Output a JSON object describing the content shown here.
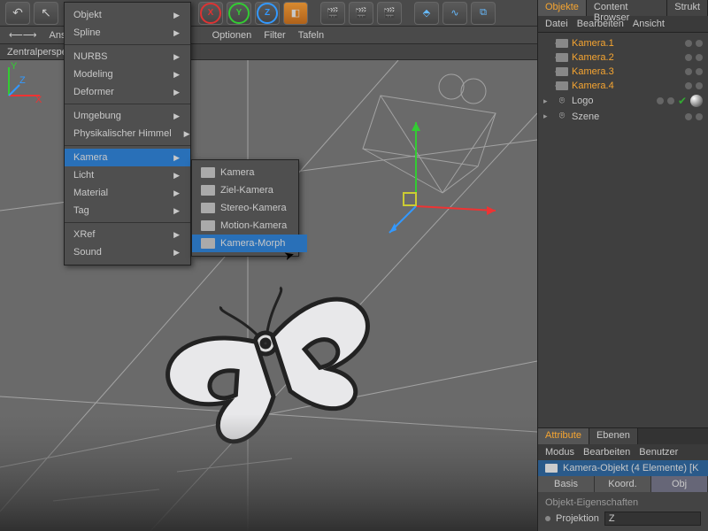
{
  "toolbar": {
    "axes": [
      "X",
      "Y",
      "Z"
    ]
  },
  "viewport_bar": {
    "ansicht": "Ansicht",
    "kameras": "",
    "optionen": "Optionen",
    "filter": "Filter",
    "tafeln": "Tafeln"
  },
  "persp": "Zentralperspe",
  "menu1": [
    {
      "label": "Objekt",
      "arrow": true
    },
    {
      "label": "Spline",
      "arrow": true
    },
    {
      "sep": true
    },
    {
      "label": "NURBS",
      "arrow": true
    },
    {
      "label": "Modeling",
      "arrow": true
    },
    {
      "label": "Deformer",
      "arrow": true
    },
    {
      "sep": true
    },
    {
      "label": "Umgebung",
      "arrow": true
    },
    {
      "label": "Physikalischer Himmel",
      "arrow": true
    },
    {
      "sep": true
    },
    {
      "label": "Kamera",
      "arrow": true,
      "hi": true
    },
    {
      "label": "Licht",
      "arrow": true
    },
    {
      "label": "Material",
      "arrow": true
    },
    {
      "label": "Tag",
      "arrow": true
    },
    {
      "sep": true
    },
    {
      "label": "XRef",
      "arrow": true
    },
    {
      "label": "Sound",
      "arrow": true
    }
  ],
  "menu2": [
    {
      "label": "Kamera"
    },
    {
      "label": "Ziel-Kamera"
    },
    {
      "label": "Stereo-Kamera"
    },
    {
      "label": "Motion-Kamera"
    },
    {
      "label": "Kamera-Morph",
      "hi": true
    }
  ],
  "objects_panel": {
    "tabs": [
      "Objekte",
      "Content Browser",
      "Strukt"
    ],
    "menu": [
      "Datei",
      "Bearbeiten",
      "Ansicht"
    ],
    "tree": [
      {
        "name": "Kamera.1",
        "cam": true,
        "sel": true
      },
      {
        "name": "Kamera.2",
        "cam": true,
        "sel": true
      },
      {
        "name": "Kamera.3",
        "cam": true,
        "sel": true
      },
      {
        "name": "Kamera.4",
        "cam": true,
        "sel": true
      },
      {
        "name": "Logo",
        "exp": true,
        "check": true,
        "ball": true
      },
      {
        "name": "Szene",
        "exp": true
      }
    ]
  },
  "attributes": {
    "tabs": [
      "Attribute",
      "Ebenen"
    ],
    "menu": [
      "Modus",
      "Bearbeiten",
      "Benutzer"
    ],
    "title": "Kamera-Objekt (4 Elemente) [K",
    "subtabs": [
      "Basis",
      "Koord.",
      "Obj"
    ],
    "section": "Objekt-Eigenschaften",
    "rows": [
      {
        "label": "Projektion",
        "field": "Z"
      }
    ]
  },
  "axis_labels": {
    "x": "X",
    "y": "Y",
    "z": "Z"
  }
}
